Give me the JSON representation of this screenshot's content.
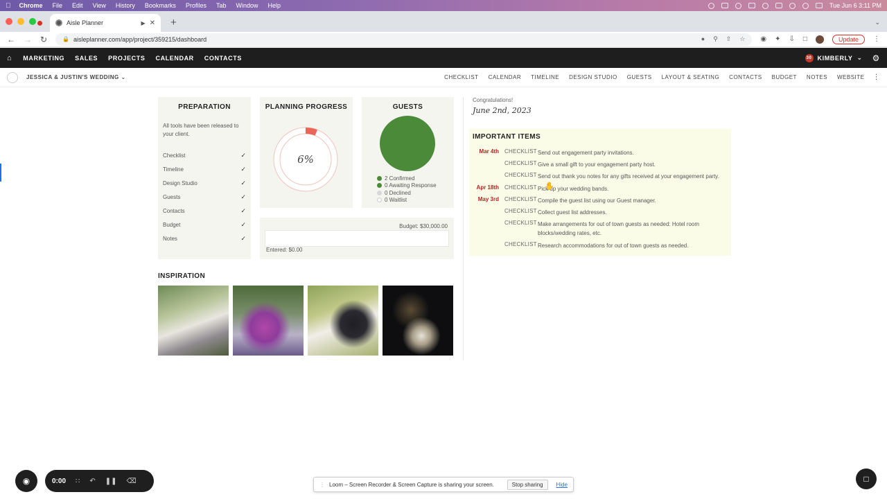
{
  "colors": {
    "accent_red": "#b22222",
    "progress_red": "#e8665a",
    "guest_green": "#4a8a38",
    "nav_dark": "#1e1e1e",
    "highlight_bg": "#fbfce8"
  },
  "mac_menu": {
    "app": "Chrome",
    "items": [
      "File",
      "Edit",
      "View",
      "History",
      "Bookmarks",
      "Profiles",
      "Tab",
      "Window",
      "Help"
    ],
    "clock": "Tue Jun 6  3:11 PM"
  },
  "browser": {
    "tab_title": "Aisle Planner",
    "url": "aisleplanner.com/app/project/359215/dashboard",
    "update_label": "Update"
  },
  "app_nav": {
    "items": [
      "MARKETING",
      "SALES",
      "PROJECTS",
      "CALENDAR",
      "CONTACTS"
    ],
    "user_badge": "30",
    "user_name": "KIMBERLY"
  },
  "project_nav": {
    "project_name": "JESSICA & JUSTIN'S WEDDING",
    "items": [
      "CHECKLIST",
      "CALENDAR",
      "TIMELINE",
      "DESIGN STUDIO",
      "GUESTS",
      "LAYOUT & SEATING",
      "CONTACTS",
      "BUDGET",
      "NOTES",
      "WEBSITE"
    ]
  },
  "preparation": {
    "title": "PREPARATION",
    "description": "All tools have been released to your client.",
    "tools": [
      "Checklist",
      "Timeline",
      "Design Studio",
      "Guests",
      "Contacts",
      "Budget",
      "Notes"
    ]
  },
  "planning_progress": {
    "title": "PLANNING PROGRESS",
    "percent_label": "6%",
    "percent": 6
  },
  "guests": {
    "title": "GUESTS",
    "legend": [
      {
        "label": "2 Confirmed",
        "color": "#4a8a38"
      },
      {
        "label": "0 Awaiting Response",
        "color": "#4a8a38"
      },
      {
        "label": "0 Declined",
        "color": "#d8d8d8"
      },
      {
        "label": "0 Waitlist",
        "color": "#ffffff"
      }
    ]
  },
  "budget": {
    "budget_label": "Budget: $30,000.00",
    "entered_label": "Entered: $0.00",
    "fraction": 0
  },
  "inspiration": {
    "title": "INSPIRATION"
  },
  "wedding": {
    "congrats": "Congratulations!",
    "date": "June 2nd, 2023"
  },
  "important_items": {
    "title": "IMPORTANT ITEMS",
    "items": [
      {
        "date": "Mar 4th",
        "category": "CHECKLIST",
        "text": "Send out engagement party invitations."
      },
      {
        "date": "",
        "category": "CHECKLIST",
        "text": "Give a small gift to your engagement party host."
      },
      {
        "date": "",
        "category": "CHECKLIST",
        "text": "Send out thank you notes for any gifts received at your engagement party."
      },
      {
        "date": "Apr 18th",
        "category": "CHECKLIST",
        "text": "Pick up your wedding bands."
      },
      {
        "date": "May 3rd",
        "category": "CHECKLIST",
        "text": "Compile the guest list using our Guest manager."
      },
      {
        "date": "",
        "category": "CHECKLIST",
        "text": "Collect guest list addresses."
      },
      {
        "date": "",
        "category": "CHECKLIST",
        "text": "Make arrangements for out of town guests as needed: Hotel room blocks/wedding rates, etc."
      },
      {
        "date": "",
        "category": "CHECKLIST",
        "text": "Research accommodations for out of town guests as needed."
      }
    ]
  },
  "loom": {
    "time": "0:00",
    "share_text": "Loom – Screen Recorder & Screen Capture is sharing your screen.",
    "stop_label": "Stop sharing",
    "hide_label": "Hide"
  }
}
